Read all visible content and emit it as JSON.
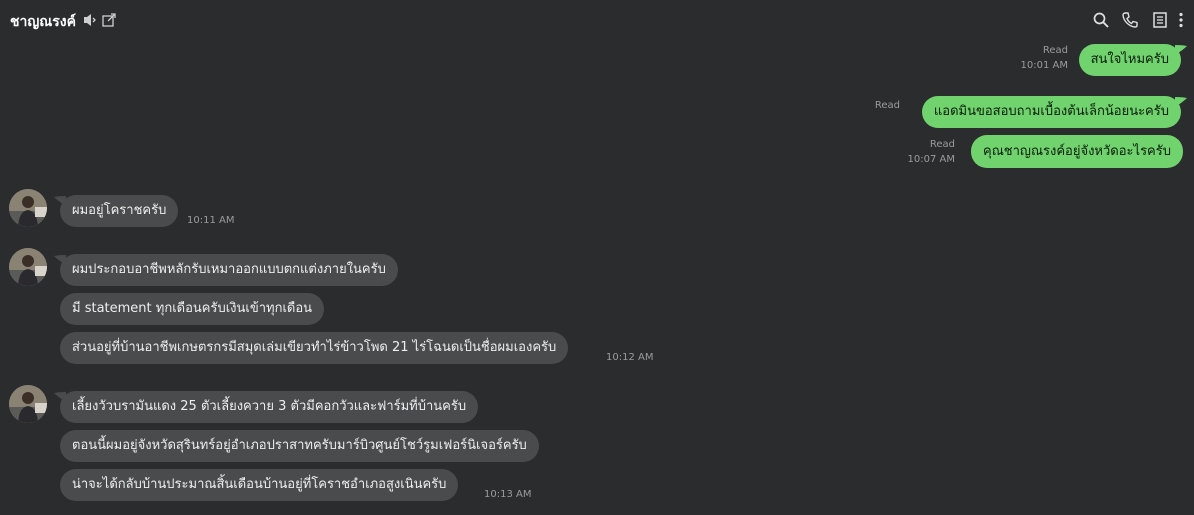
{
  "header": {
    "title": "ชาญณรงค์",
    "icons": [
      "mute-speaker-icon",
      "open-external-icon",
      "search-icon",
      "phone-icon",
      "notes-icon",
      "more-vertical-icon"
    ]
  },
  "messages_out": [
    {
      "text": "สนใจไหมครับ",
      "status": "Read",
      "time": "10:01 AM"
    },
    {
      "text": "แอดมินขอสอบถามเบื้องต้นเล็กน้อยนะครับ",
      "status": "Read",
      "time": ""
    },
    {
      "text": "คุณชาญณรงค์อยู่จังหวัดอะไรครับ",
      "status": "Read",
      "time": "10:07 AM"
    }
  ],
  "messages_in": [
    {
      "text": "ผมอยู่โคราชครับ",
      "time": "10:11 AM"
    },
    {
      "text": "ผมประกอบอาชีพหลักรับเหมาออกแบบตกแต่งภายในครับ",
      "time": ""
    },
    {
      "text": "มี statement ทุกเดือนครับเงินเข้าทุกเดือน",
      "time": ""
    },
    {
      "text": "ส่วนอยู่ที่บ้านอาชีพเกษตรกรมีสมุดเล่มเขียวทำไร่ข้าวโพด 21 ไร่โฉนดเป็นชื่อผมเองครับ",
      "time": "10:12 AM"
    },
    {
      "text": "เลี้ยงวัวบรามันแดง 25 ตัวเลี้ยงควาย 3 ตัวมีคอกวัวและฟาร์มที่บ้านครับ",
      "time": ""
    },
    {
      "text": "ตอนนี้ผมอยู่จังหวัดสุรินทร์อยู่อำเภอปราสาทครับมาร์บิวศูนย์โชว์รูมเฟอร์นิเจอร์ครับ",
      "time": ""
    },
    {
      "text": "น่าจะได้กลับบ้านประมาณสิ้นเดือนบ้านอยู่ที่โคราชอำเภอสูงเนินครับ",
      "time": "10:13 AM"
    }
  ],
  "colors": {
    "background": "#2b2c2e",
    "outgoing_bubble": "#71d36e",
    "incoming_bubble": "#4a4b4d",
    "meta_text": "#9a9b9d"
  }
}
